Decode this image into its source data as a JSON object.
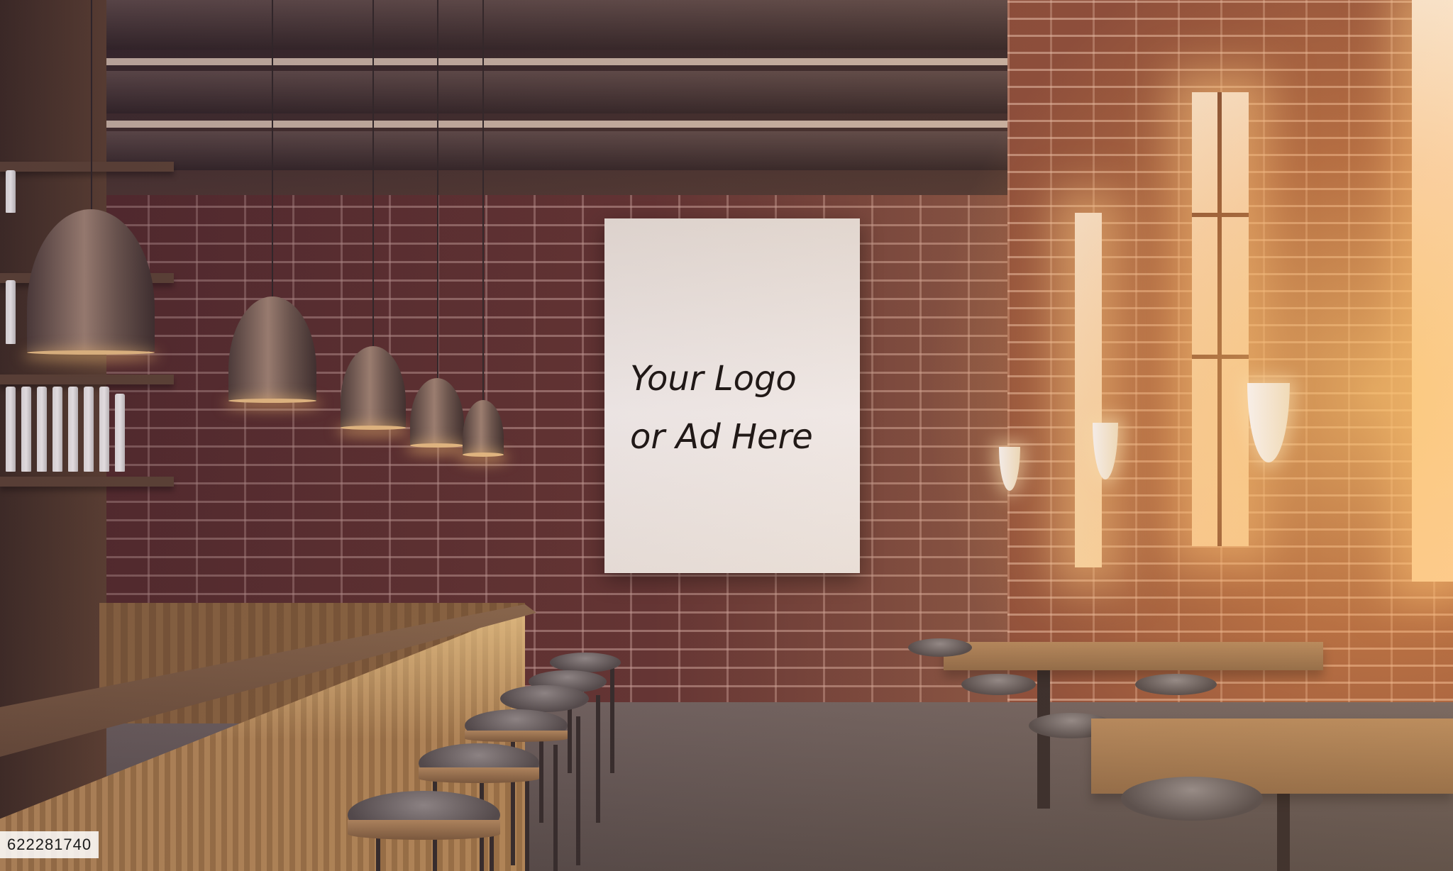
{
  "poster": {
    "text": "Your Logo\nor Ad Here"
  },
  "image_id": "622281740",
  "scene": {
    "description_tags": [
      "bar-counter",
      "bar-stools",
      "pendant-lamps",
      "brick-wall",
      "windows",
      "wall-sconces",
      "tables",
      "blank-poster"
    ],
    "colors": {
      "brick": "#5e2f30",
      "sunlight": "#ffc878",
      "wood": "#b48a5e",
      "poster": "#ffffff"
    }
  }
}
